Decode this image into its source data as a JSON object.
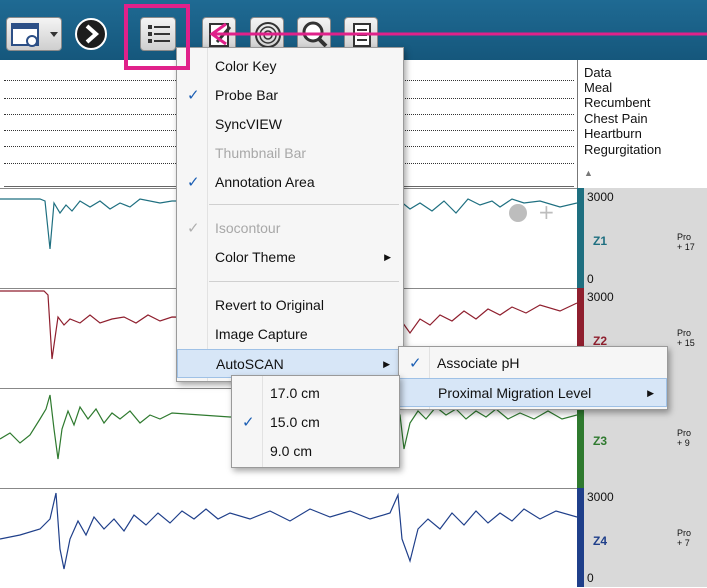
{
  "toolbar": {
    "buttons": [
      {
        "name": "view-selector",
        "icon": "window-dropdown-icon"
      },
      {
        "name": "play",
        "icon": "play-icon"
      },
      {
        "name": "display-options",
        "icon": "checklist-icon"
      },
      {
        "name": "edit",
        "icon": "pencil-icon"
      },
      {
        "name": "fingerprint",
        "icon": "fingerprint-icon"
      },
      {
        "name": "zoom",
        "icon": "magnifier-icon"
      },
      {
        "name": "report",
        "icon": "document-icon"
      }
    ],
    "highlight_color": "#e0218a"
  },
  "annotation_legend": [
    "Data",
    "Meal",
    "Recumbent",
    "Chest Pain",
    "Heartburn",
    "Regurgitation"
  ],
  "zones": [
    {
      "label": "Z1",
      "max": "3000",
      "min": "0",
      "color": "#1e6f80",
      "probe_lines": [
        "Pro",
        "+ 17"
      ]
    },
    {
      "label": "Z2",
      "max": "3000",
      "min": "",
      "color": "#8f1f2e",
      "probe_lines": [
        "Pro",
        "+ 15"
      ]
    },
    {
      "label": "Z3",
      "max": "",
      "min": "",
      "color": "#2f7a2f",
      "probe_lines": [
        "Pro",
        "+ 9"
      ]
    },
    {
      "label": "Z4",
      "max": "3000",
      "min": "0",
      "color": "#1f3f8a",
      "probe_lines": [
        "Pro",
        "+ 7"
      ]
    }
  ],
  "main_menu": [
    {
      "label": "Color Key",
      "checked": false,
      "disabled": false,
      "submenu": false
    },
    {
      "label": "Probe Bar",
      "checked": true,
      "disabled": false,
      "submenu": false
    },
    {
      "label": "SyncVIEW",
      "checked": false,
      "disabled": false,
      "submenu": false
    },
    {
      "label": "Thumbnail Bar",
      "checked": false,
      "disabled": true,
      "submenu": false
    },
    {
      "label": "Annotation Area",
      "checked": true,
      "disabled": false,
      "submenu": false
    },
    {
      "label": "Isocontour",
      "checked": true,
      "disabled": true,
      "submenu": false
    },
    {
      "label": "Color Theme",
      "checked": false,
      "disabled": false,
      "submenu": true
    },
    {
      "label": "Revert to Original",
      "checked": false,
      "disabled": false,
      "submenu": false
    },
    {
      "label": "Image Capture",
      "checked": false,
      "disabled": false,
      "submenu": false
    },
    {
      "label": "AutoSCAN",
      "checked": false,
      "disabled": false,
      "submenu": true,
      "highlighted": true
    }
  ],
  "autoscan_menu": [
    {
      "label": "Associate pH",
      "checked": true,
      "submenu": false
    },
    {
      "label": "Proximal Migration Level",
      "checked": false,
      "submenu": true,
      "highlighted": true
    }
  ],
  "level_menu": [
    {
      "label": "17.0 cm",
      "checked": false
    },
    {
      "label": "15.0 cm",
      "checked": true
    },
    {
      "label": "9.0 cm",
      "checked": false
    }
  ],
  "icons": {
    "check": "✓",
    "submenu_arrow": "▶",
    "collapse_arrow": "▲"
  }
}
